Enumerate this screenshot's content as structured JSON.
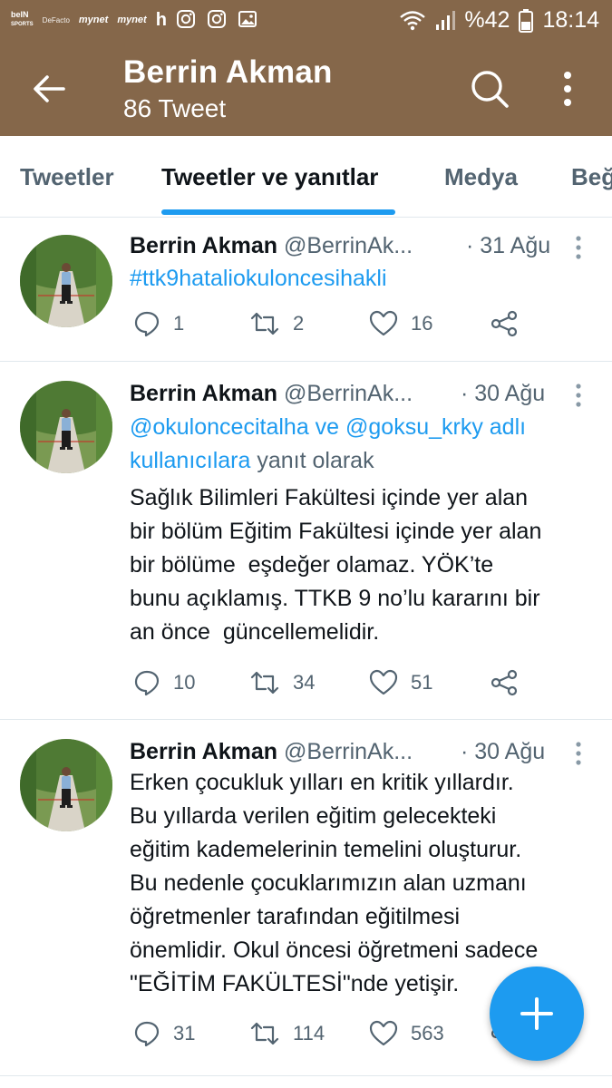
{
  "status_bar": {
    "apps": [
      "beIN",
      "SPORTS",
      "DeFacto",
      "mynet",
      "mynet",
      "h"
    ],
    "battery": "%42",
    "time": "18:14"
  },
  "app_bar": {
    "title": "Berrin Akman",
    "subtitle": "86 Tweet"
  },
  "tabs": [
    {
      "label": "Tweetler"
    },
    {
      "label": "Tweetler ve yanıtlar"
    },
    {
      "label": "Medya"
    },
    {
      "label": "Beğ"
    }
  ],
  "tweets": [
    {
      "name": "Berrin Akman",
      "handle": "@BerrinAk...",
      "date": "· 31 Ağu",
      "lines": [
        "#ttk9hataliokuloncesihakli"
      ],
      "replies": "1",
      "retweets": "2",
      "likes": "16"
    },
    {
      "name": "Berrin Akman",
      "handle": "@BerrinAk...",
      "date": "· 30 Ağu",
      "reply_to": {
        "line1": "@okuloncecitalha ve @goksu_krky adlı",
        "line2_link": "kullanıcılara",
        "line2_rest": " yanıt olarak"
      },
      "lines": [
        "Sağlık Bilimleri Fakültesi içinde yer alan",
        "bir bölüm Eğitim Fakültesi içinde yer alan",
        "bir bölüme  eşdeğer olamaz. YÖK’te",
        "bunu açıklamış. TTKB 9 no’lu kararını bir",
        "an önce  güncellemelidir."
      ],
      "replies": "10",
      "retweets": "34",
      "likes": "51"
    },
    {
      "name": "Berrin Akman",
      "handle": "@BerrinAk...",
      "date": "· 30 Ağu",
      "lines": [
        "Erken çocukluk yılları en kritik yıllardır.",
        "Bu yıllarda verilen eğitim gelecekteki",
        "eğitim kademelerinin temelini oluşturur.",
        "Bu nedenle çocuklarımızın alan uzmanı",
        "öğretmenler tarafından eğitilmesi",
        "önemlidir. Okul öncesi öğretmeni sadece",
        "\"EĞİTİM FAKÜLTESİ\"nde yetişir."
      ],
      "replies": "31",
      "retweets": "114",
      "likes": "563"
    }
  ],
  "colors": {
    "header_bg": "#85674a",
    "accent": "#1d9bf0",
    "muted_text": "#536471"
  },
  "icons": [
    "back-arrow-icon",
    "search-icon",
    "more-vertical-icon",
    "reply-icon",
    "retweet-icon",
    "like-icon",
    "share-icon",
    "compose-plus-icon"
  ]
}
